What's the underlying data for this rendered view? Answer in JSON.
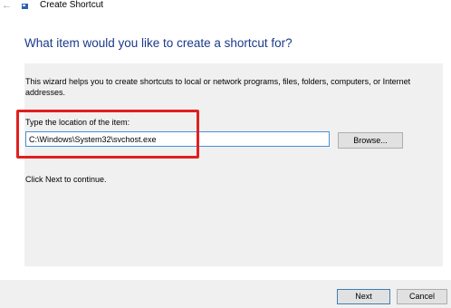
{
  "window": {
    "title": "Create Shortcut",
    "back_icon": "back-arrow-icon"
  },
  "wizard": {
    "heading": "What item would you like to create a shortcut for?",
    "description": "This wizard helps you to create shortcuts to local or network programs, files, folders, computers, or Internet addresses.",
    "location_label": "Type the location of the item:",
    "location_value": "C:\\Windows\\System32\\svchost.exe",
    "browse_label": "Browse...",
    "hint": "Click Next to continue."
  },
  "footer": {
    "next_label": "Next",
    "cancel_label": "Cancel"
  },
  "colors": {
    "heading": "#1a3a8a",
    "highlight": "#e02020",
    "panel": "#f0f0f0",
    "input_border": "#4a90d9"
  }
}
